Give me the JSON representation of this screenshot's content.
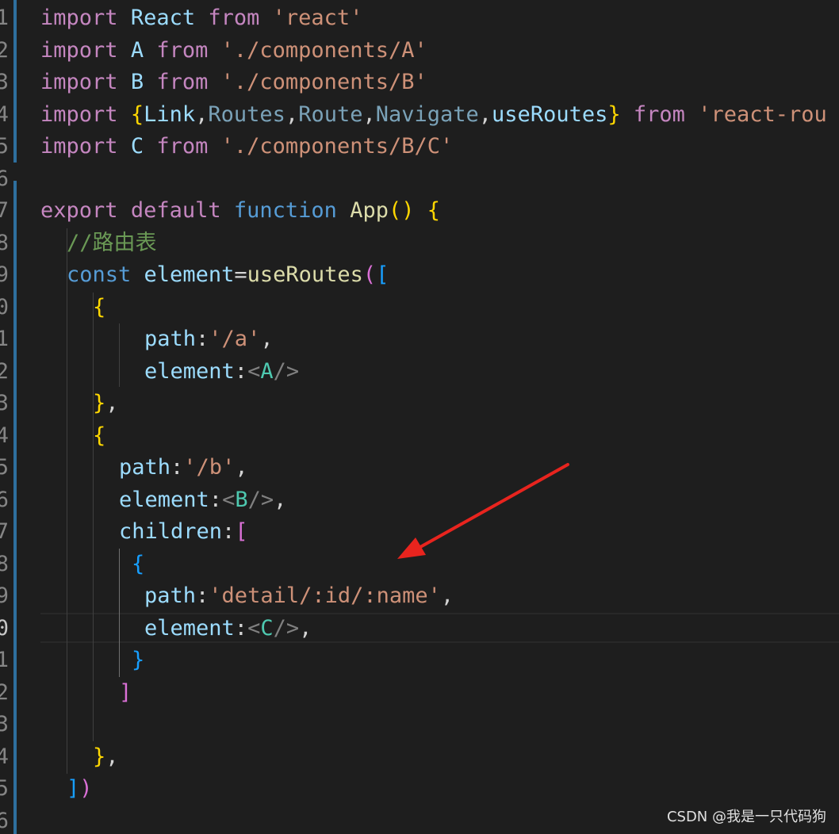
{
  "line_numbers": [
    "1",
    "2",
    "3",
    "4",
    "5",
    "6",
    "7",
    "8",
    "9",
    "0",
    "1",
    "2",
    "3",
    "4",
    "5",
    "6",
    "7",
    "8",
    "9",
    "0",
    "1",
    "2",
    "3",
    "4",
    "5",
    "6"
  ],
  "active_line_number": "0",
  "tokens": {
    "import": "import",
    "from": "from",
    "export": "export",
    "default": "default",
    "function": "function",
    "const": "const",
    "React": "React",
    "A": "A",
    "B": "B",
    "C": "C",
    "str_react": "'react'",
    "str_a": "'./components/A'",
    "str_b": "'./components/B'",
    "str_c": "'./components/B/C'",
    "str_router": "'react-rou",
    "Link": "Link",
    "Routes": "Routes",
    "Route": "Route",
    "Navigate": "Navigate",
    "useRoutes": "useRoutes",
    "App": "App",
    "comment": "//路由表",
    "element": "element",
    "path": "path",
    "children": "children",
    "path_a": "'/a'",
    "path_b": "'/b'",
    "path_detail": "'detail/:id/:name'"
  },
  "watermark": "CSDN @我是一只代码狗",
  "colors": {
    "background": "#1e1e1e",
    "arrow": "#e8241e"
  }
}
